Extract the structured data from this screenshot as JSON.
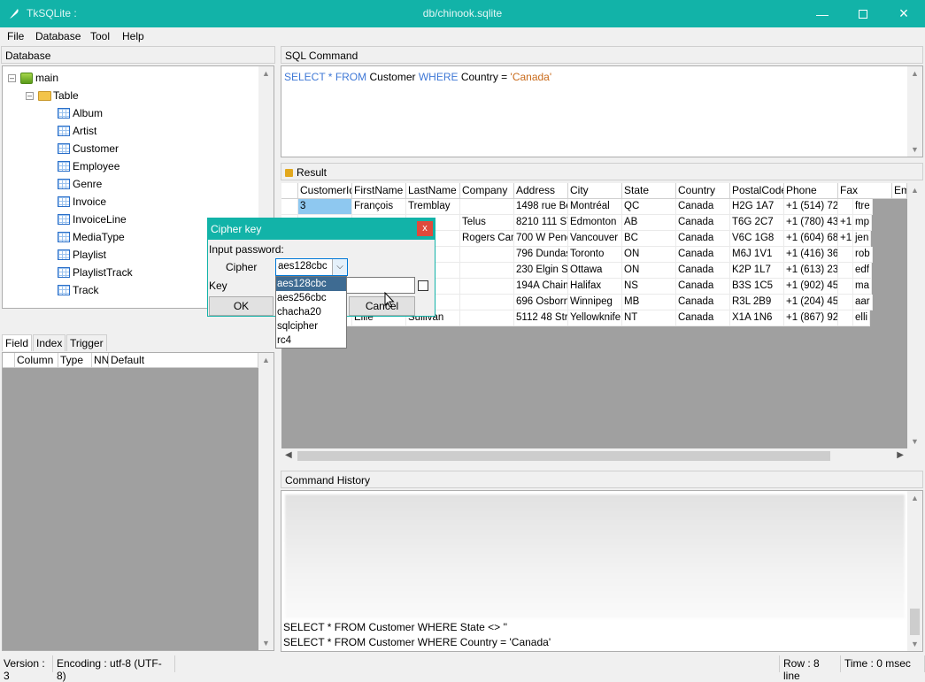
{
  "app": {
    "name": "TkSQLite :",
    "window_title": "db/chinook.sqlite"
  },
  "menu": [
    "File",
    "Database",
    "Tool",
    "Help"
  ],
  "database_panel": {
    "header": "Database",
    "tree": {
      "root": "main",
      "folder": "Table",
      "tables": [
        "Album",
        "Artist",
        "Customer",
        "Employee",
        "Genre",
        "Invoice",
        "InvoiceLine",
        "MediaType",
        "Playlist",
        "PlaylistTrack",
        "Track"
      ]
    }
  },
  "field_tabs": [
    "Field",
    "Index",
    "Trigger"
  ],
  "field_columns": [
    "Column",
    "Type",
    "NN",
    "Default"
  ],
  "sql_panel": {
    "header": "SQL Command",
    "query": {
      "select": "SELECT",
      "star": " * ",
      "from": "FROM",
      "table": " Customer ",
      "where": "WHERE",
      "cond": " Country = ",
      "value": "'Canada'"
    }
  },
  "result_panel": {
    "header": "Result",
    "columns": [
      "CustomerId",
      "FirstName",
      "LastName",
      "Company",
      "Address",
      "City",
      "State",
      "Country",
      "PostalCode",
      "Phone",
      "Fax",
      "Em"
    ],
    "rows": [
      [
        "3",
        "François",
        "Tremblay",
        "",
        "1498 rue Bé",
        "Montréal",
        "QC",
        "Canada",
        "H2G 1A7",
        "+1 (514) 72",
        "",
        "ftre"
      ],
      [
        "",
        "",
        "s",
        "Telus",
        "8210 111 ST",
        "Edmonton",
        "AB",
        "Canada",
        "T6G 2C7",
        "+1 (780) 43",
        "+1 (780) 43",
        "mp"
      ],
      [
        "",
        "",
        "on",
        "Rogers Can",
        "700 W Pend",
        "Vancouver",
        "BC",
        "Canada",
        "V6C 1G8",
        "+1 (604) 68",
        "+1 (604) 68",
        "jen"
      ],
      [
        "",
        "",
        "n",
        "",
        "796 Dundas",
        "Toronto",
        "ON",
        "Canada",
        "M6J 1V1",
        "+1 (416) 36",
        "",
        "rob"
      ],
      [
        "",
        "",
        "s",
        "",
        "230 Elgin St",
        "Ottawa",
        "ON",
        "Canada",
        "K2P 1L7",
        "+1 (613) 23",
        "",
        "edf"
      ],
      [
        "",
        "",
        "",
        "",
        "194A Chain",
        "Halifax",
        "NS",
        "Canada",
        "B3S 1C5",
        "+1 (902) 45",
        "",
        "ma"
      ],
      [
        "",
        "",
        "ell",
        "",
        "696 Osborn",
        "Winnipeg",
        "MB",
        "Canada",
        "R3L 2B9",
        "+1 (204) 45",
        "",
        "aar"
      ],
      [
        "",
        "Ellie",
        "Sullivan",
        "",
        "5112 48 Stre",
        "Yellowknife",
        "NT",
        "Canada",
        "X1A 1N6",
        "+1 (867) 92",
        "",
        "elli"
      ]
    ]
  },
  "history_panel": {
    "header": "Command History",
    "lines": [
      "SELECT * FROM Customer WHERE State <> ''",
      "SELECT * FROM Customer WHERE Country = 'Canada'"
    ]
  },
  "status": {
    "version": "Version : 3",
    "encoding": "Encoding : utf-8 (UTF-8)",
    "rows": "Row : 8 line",
    "time": "Time : 0 msec"
  },
  "dialog": {
    "title": "Cipher key",
    "close": "x",
    "prompt": "Input password:",
    "cipher_label": "Cipher",
    "cipher_value": "aes128cbc",
    "key_label": "Key",
    "ok": "OK",
    "cancel": "Cancel",
    "options": [
      "aes128cbc",
      "aes256cbc",
      "chacha20",
      "sqlcipher",
      "rc4"
    ]
  },
  "colors": {
    "accent": "#12b3a8",
    "selected_option": "#3e6b92",
    "keyword": "#3f78d6",
    "string": "#c96a1a"
  }
}
